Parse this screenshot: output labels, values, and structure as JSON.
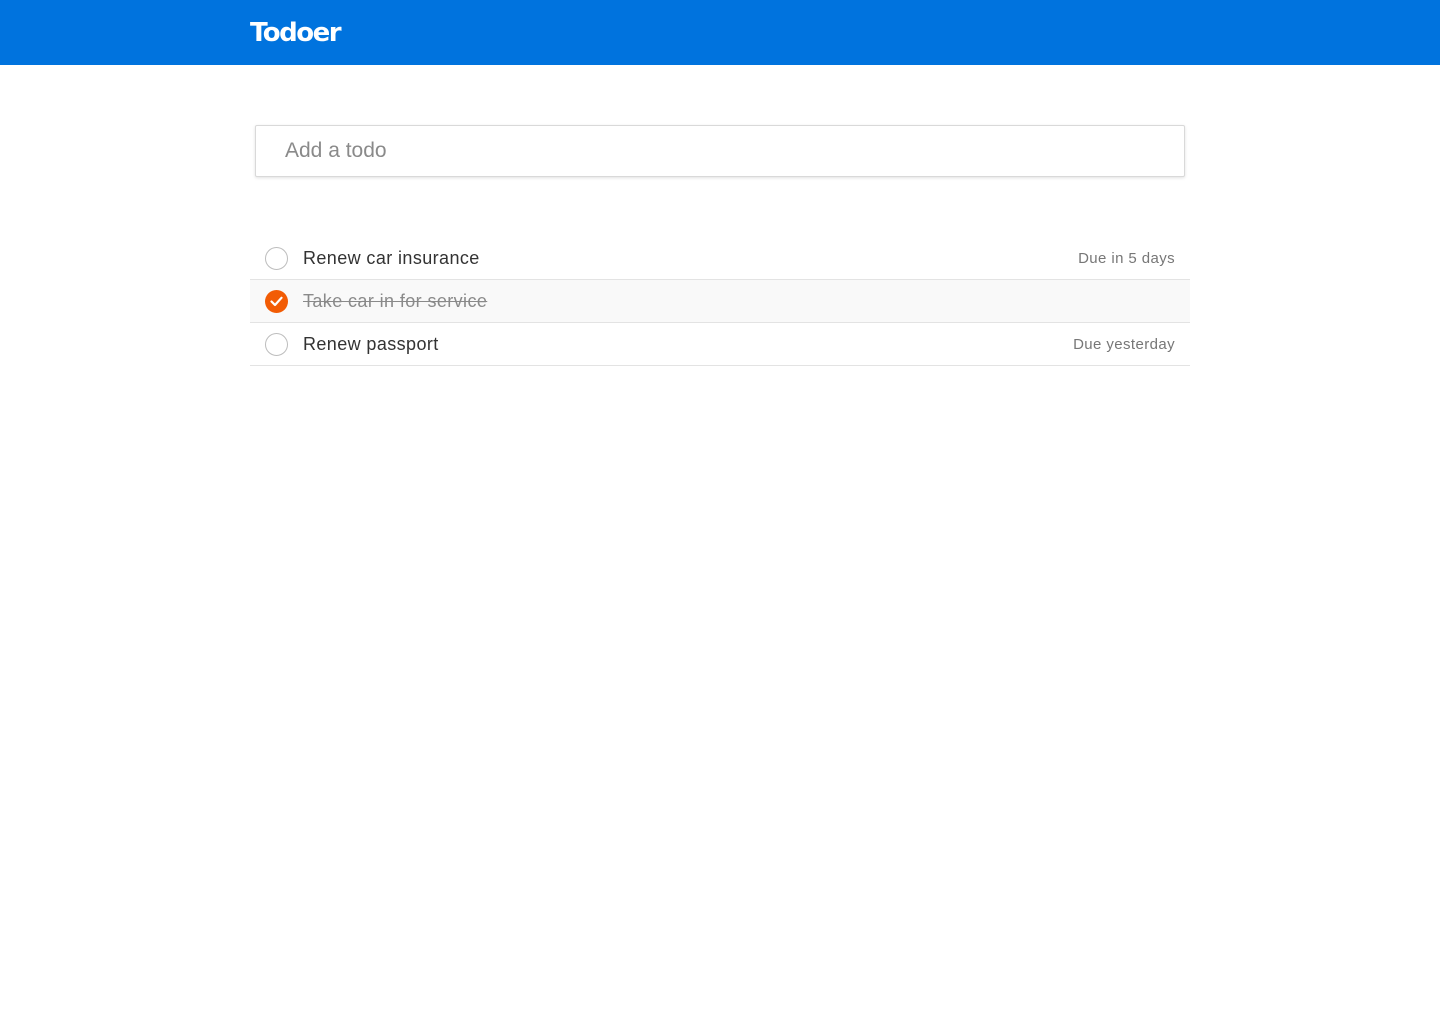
{
  "app": {
    "title": "Todoer",
    "brand_color": "#0073de"
  },
  "add_todo": {
    "placeholder": "Add a todo",
    "value": ""
  },
  "todos": [
    {
      "label": "Renew car insurance",
      "due": "Due in 5 days",
      "completed": false
    },
    {
      "label": "Take car in for service",
      "due": "",
      "completed": true
    },
    {
      "label": "Renew passport",
      "due": "Due yesterday",
      "completed": false
    }
  ],
  "colors": {
    "check_done": "#f25c05",
    "row_done_bg": "#f9f9f9"
  },
  "icons": {
    "checkmark": "checkmark-icon"
  }
}
